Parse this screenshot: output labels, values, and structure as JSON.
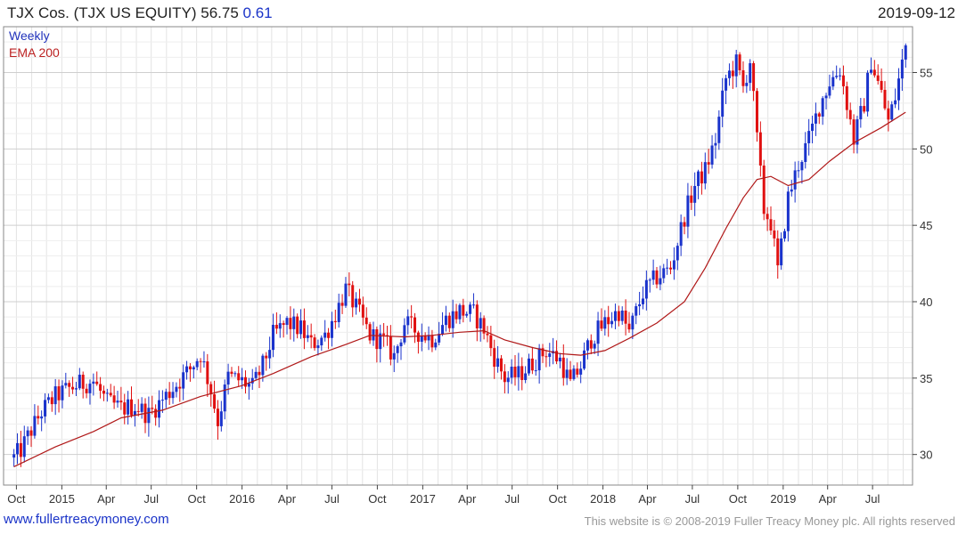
{
  "header": {
    "symbol_text": "TJX Cos. (TJX US EQUITY) 56.75",
    "change_text": "0.61",
    "date": "2019-09-12"
  },
  "legend": {
    "weekly_label": "Weekly",
    "ema_label": "EMA 200"
  },
  "footer": {
    "left_link": "www.fullertreacymoney.com",
    "right_text": "This website is © 2008-2019 Fuller Treacy Money plc. All rights reserved"
  },
  "colors": {
    "up": "#1a33cc",
    "down": "#e01010",
    "ema": "#b01818",
    "grid": "#e3e3e3",
    "axis": "#444444"
  },
  "chart_data": {
    "type": "line",
    "title": "TJX Cos. (TJX US EQUITY)",
    "last": 56.75,
    "change": 0.61,
    "y_axis": {
      "min": 28,
      "max": 58,
      "ticks": [
        30,
        35,
        40,
        45,
        50,
        55
      ],
      "side": "right"
    },
    "x_axis": {
      "ticks": [
        "Oct",
        "2015",
        "Apr",
        "Jul",
        "Oct",
        "2016",
        "Apr",
        "Jul",
        "Oct",
        "2017",
        "Apr",
        "Jul",
        "Oct",
        "2018",
        "Apr",
        "Jul",
        "Oct",
        "2019",
        "Apr",
        "Jul"
      ]
    },
    "grid": true,
    "series": [
      {
        "name": "Weekly",
        "kind": "weekly_price",
        "points": [
          [
            "2014-09-26",
            29.8
          ],
          [
            "2014-10-10",
            30.3
          ],
          [
            "2014-10-31",
            31.6
          ],
          [
            "2014-11-21",
            32.8
          ],
          [
            "2014-12-19",
            33.8
          ],
          [
            "2015-01-09",
            34.2
          ],
          [
            "2015-02-06",
            34.6
          ],
          [
            "2015-03-06",
            34.8
          ],
          [
            "2015-04-03",
            33.4
          ],
          [
            "2015-05-01",
            33.0
          ],
          [
            "2015-05-29",
            33.2
          ],
          [
            "2015-06-26",
            32.6
          ],
          [
            "2015-07-24",
            33.6
          ],
          [
            "2015-08-21",
            34.6
          ],
          [
            "2015-09-18",
            35.6
          ],
          [
            "2015-10-09",
            36.6
          ],
          [
            "2015-10-30",
            34.2
          ],
          [
            "2015-11-13",
            32.2
          ],
          [
            "2015-12-04",
            35.1
          ],
          [
            "2015-12-31",
            34.8
          ],
          [
            "2016-01-22",
            34.4
          ],
          [
            "2016-02-12",
            35.8
          ],
          [
            "2016-03-04",
            37.8
          ],
          [
            "2016-04-01",
            38.6
          ],
          [
            "2016-04-29",
            38.2
          ],
          [
            "2016-05-20",
            37.2
          ],
          [
            "2016-06-17",
            37.8
          ],
          [
            "2016-07-08",
            39.2
          ],
          [
            "2016-07-29",
            40.8
          ],
          [
            "2016-08-19",
            39.6
          ],
          [
            "2016-09-16",
            37.8
          ],
          [
            "2016-10-14",
            37.4
          ],
          [
            "2016-11-04",
            36.4
          ],
          [
            "2016-11-25",
            38.6
          ],
          [
            "2016-12-23",
            38.0
          ],
          [
            "2017-01-20",
            37.6
          ],
          [
            "2017-02-17",
            38.8
          ],
          [
            "2017-03-17",
            39.4
          ],
          [
            "2017-04-14",
            39.2
          ],
          [
            "2017-05-05",
            38.2
          ],
          [
            "2017-05-26",
            36.4
          ],
          [
            "2017-06-16",
            35.0
          ],
          [
            "2017-07-14",
            35.2
          ],
          [
            "2017-08-11",
            36.0
          ],
          [
            "2017-09-08",
            36.8
          ],
          [
            "2017-10-06",
            36.2
          ],
          [
            "2017-10-27",
            34.6
          ],
          [
            "2017-11-17",
            35.8
          ],
          [
            "2017-12-08",
            37.6
          ],
          [
            "2018-01-05",
            38.6
          ],
          [
            "2018-02-02",
            39.4
          ],
          [
            "2018-02-23",
            38.0
          ],
          [
            "2018-03-23",
            40.6
          ],
          [
            "2018-04-20",
            41.6
          ],
          [
            "2018-05-18",
            42.2
          ],
          [
            "2018-06-15",
            45.6
          ],
          [
            "2018-07-06",
            47.6
          ],
          [
            "2018-07-27",
            48.6
          ],
          [
            "2018-08-17",
            50.6
          ],
          [
            "2018-09-07",
            54.6
          ],
          [
            "2018-09-28",
            55.6
          ],
          [
            "2018-10-12",
            54.0
          ],
          [
            "2018-10-26",
            55.8
          ],
          [
            "2018-11-09",
            50.6
          ],
          [
            "2018-11-23",
            46.0
          ],
          [
            "2018-12-07",
            45.2
          ],
          [
            "2018-12-21",
            42.0
          ],
          [
            "2019-01-11",
            46.8
          ],
          [
            "2019-02-01",
            49.0
          ],
          [
            "2019-02-22",
            50.6
          ],
          [
            "2019-03-15",
            52.8
          ],
          [
            "2019-04-05",
            54.4
          ],
          [
            "2019-04-26",
            55.2
          ],
          [
            "2019-05-10",
            53.0
          ],
          [
            "2019-05-24",
            50.6
          ],
          [
            "2019-06-14",
            53.0
          ],
          [
            "2019-06-28",
            55.8
          ],
          [
            "2019-07-19",
            53.6
          ],
          [
            "2019-08-02",
            51.8
          ],
          [
            "2019-08-16",
            53.4
          ],
          [
            "2019-09-06",
            56.75
          ]
        ]
      },
      {
        "name": "EMA 200",
        "kind": "line",
        "points": [
          [
            "2014-09-26",
            29.2
          ],
          [
            "2014-12-19",
            30.5
          ],
          [
            "2015-03-06",
            31.5
          ],
          [
            "2015-05-01",
            32.4
          ],
          [
            "2015-07-24",
            32.9
          ],
          [
            "2015-10-09",
            33.8
          ],
          [
            "2015-12-31",
            34.5
          ],
          [
            "2016-03-04",
            35.3
          ],
          [
            "2016-05-20",
            36.4
          ],
          [
            "2016-07-29",
            37.2
          ],
          [
            "2016-09-16",
            37.8
          ],
          [
            "2016-11-25",
            37.7
          ],
          [
            "2017-01-20",
            37.8
          ],
          [
            "2017-03-17",
            38.0
          ],
          [
            "2017-05-05",
            38.1
          ],
          [
            "2017-06-16",
            37.5
          ],
          [
            "2017-08-11",
            37.0
          ],
          [
            "2017-10-06",
            36.6
          ],
          [
            "2017-11-17",
            36.5
          ],
          [
            "2018-01-05",
            36.8
          ],
          [
            "2018-02-23",
            37.6
          ],
          [
            "2018-04-20",
            38.6
          ],
          [
            "2018-06-15",
            40.0
          ],
          [
            "2018-07-27",
            42.2
          ],
          [
            "2018-09-07",
            44.8
          ],
          [
            "2018-10-12",
            46.8
          ],
          [
            "2018-11-09",
            48.0
          ],
          [
            "2018-12-07",
            48.2
          ],
          [
            "2019-01-11",
            47.6
          ],
          [
            "2019-02-22",
            48.0
          ],
          [
            "2019-04-05",
            49.2
          ],
          [
            "2019-05-24",
            50.4
          ],
          [
            "2019-07-19",
            51.4
          ],
          [
            "2019-09-06",
            52.4
          ]
        ]
      }
    ]
  }
}
